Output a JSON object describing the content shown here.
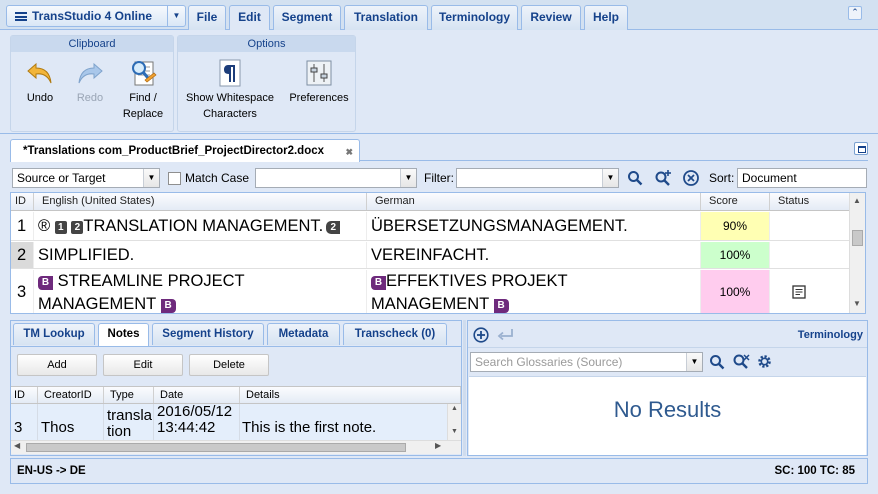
{
  "app": {
    "title": "TransStudio 4 Online"
  },
  "menu_tabs": [
    "File",
    "Edit",
    "Segment",
    "Translation",
    "Terminology",
    "Review",
    "Help"
  ],
  "ribbon": {
    "clipboard": {
      "title": "Clipboard",
      "undo": "Undo",
      "redo": "Redo",
      "find_line1": "Find /",
      "find_line2": "Replace"
    },
    "options": {
      "title": "Options",
      "whitespace_line1": "Show Whitespace",
      "whitespace_line2": "Characters",
      "preferences": "Preferences"
    }
  },
  "document_tab": {
    "label": "*Translations com_ProductBrief_ProjectDirector2.docx"
  },
  "filterbar": {
    "scope_value": "Source or Target",
    "match_case_label": "Match Case",
    "filter_label": "Filter:",
    "sort_label": "Sort:",
    "sort_value": "Document"
  },
  "grid": {
    "columns": {
      "id": "ID",
      "source": "English (United States)",
      "target": "German",
      "score": "Score",
      "status": "Status"
    },
    "rows": [
      {
        "id": "1",
        "source_prefix": "®",
        "tag1": "1",
        "tag2": "2",
        "source_text": "TRANSLATION MANAGEMENT.",
        "tag_end": "2",
        "target": "ÜBERSETZUNGSMANAGEMENT.",
        "score": "90%",
        "score_color": "#ffffb3"
      },
      {
        "id": "2",
        "source_text": "SIMPLIFIED.",
        "target": "VEREINFACHT.",
        "score": "100%",
        "score_color": "#ccffcc"
      },
      {
        "id": "3",
        "tag_open": "B",
        "source_line1": "STREAMLINE PROJECT",
        "source_line2": "MANAGEMENT",
        "tag_close": "B",
        "target_line1": "EFFEKTIVES PROJEKT",
        "target_line2": "MANAGEMENT",
        "score": "100%",
        "score_color": "#ffccee"
      }
    ]
  },
  "bottom_left": {
    "tabs": [
      "TM Lookup",
      "Notes",
      "Segment History",
      "Metadata",
      "Transcheck (0)"
    ],
    "active_tab": "Notes",
    "buttons": {
      "add": "Add",
      "edit": "Edit",
      "delete": "Delete"
    },
    "columns": {
      "id": "ID",
      "creator": "CreatorID",
      "type": "Type",
      "date": "Date",
      "details": "Details"
    },
    "row": {
      "id": "3",
      "creator": "Thos",
      "type": "translation",
      "date_line1": "2016/05/12",
      "date_line2": "13:44:42",
      "details": "This is the first note."
    }
  },
  "bottom_right": {
    "title": "Terminology",
    "search_placeholder": "Search Glossaries (Source)",
    "no_results": "No Results"
  },
  "status_bar": {
    "lang_pair": "EN-US -> DE",
    "counts": "SC: 100 TC: 85"
  },
  "colors": {
    "accent": "#15428b",
    "panel": "#dfe8f6",
    "border": "#99bbe8",
    "tag": "#6e2a7c"
  }
}
